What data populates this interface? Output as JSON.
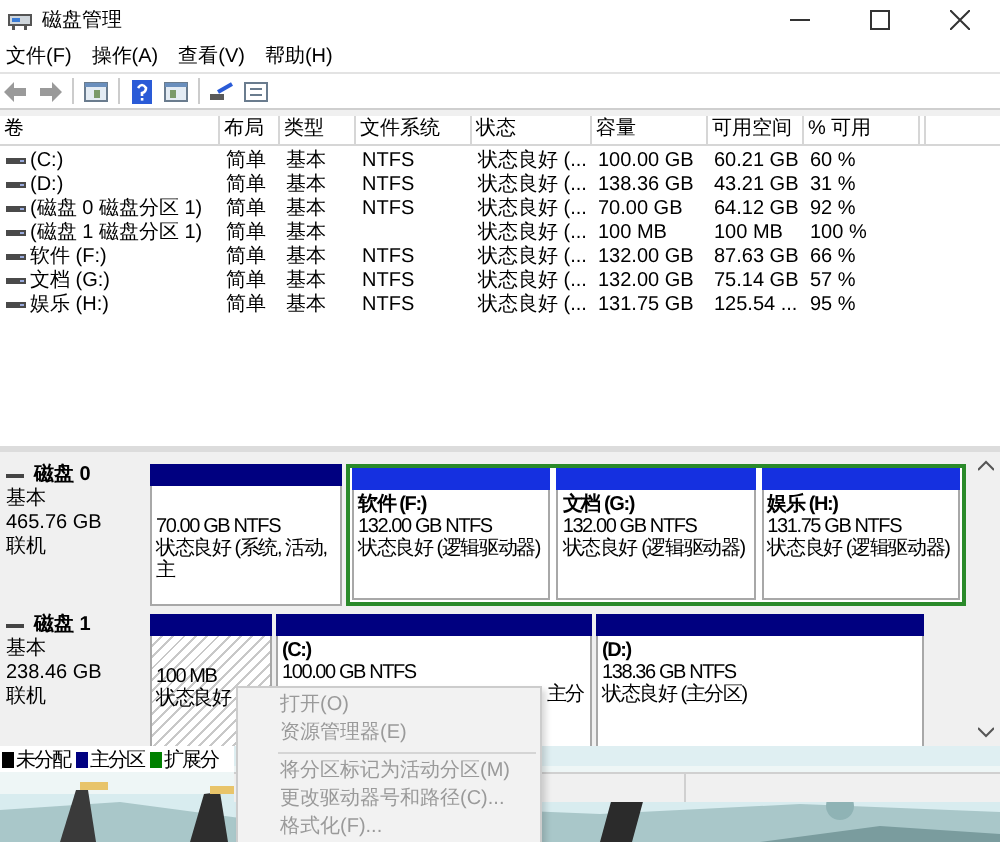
{
  "window": {
    "title": "磁盘管理"
  },
  "menu": [
    "文件(F)",
    "操作(A)",
    "查看(V)",
    "帮助(H)"
  ],
  "table": {
    "columns": [
      "卷",
      "布局",
      "类型",
      "文件系统",
      "状态",
      "容量",
      "可用空间",
      "% 可用"
    ],
    "rows": [
      {
        "volume": "(C:)",
        "layout": "简单",
        "type": "基本",
        "file_system": "NTFS",
        "status": "状态良好 (...",
        "capacity": "100.00 GB",
        "free": "60.21 GB",
        "percent_free": "60 %"
      },
      {
        "volume": "(D:)",
        "layout": "简单",
        "type": "基本",
        "file_system": "NTFS",
        "status": "状态良好 (...",
        "capacity": "138.36 GB",
        "free": "43.21 GB",
        "percent_free": "31 %"
      },
      {
        "volume": "(磁盘 0 磁盘分区 1)",
        "layout": "简单",
        "type": "基本",
        "file_system": "NTFS",
        "status": "状态良好 (...",
        "capacity": "70.00 GB",
        "free": "64.12 GB",
        "percent_free": "92 %"
      },
      {
        "volume": "(磁盘 1 磁盘分区 1)",
        "layout": "简单",
        "type": "基本",
        "status": "状态良好 (...",
        "capacity": "100 MB",
        "free": "100 MB",
        "percent_free": "100 %"
      },
      {
        "volume": "软件 (F:)",
        "layout": "简单",
        "type": "基本",
        "file_system": "NTFS",
        "status": "状态良好 (...",
        "capacity": "132.00 GB",
        "free": "87.63 GB",
        "percent_free": "66 %"
      },
      {
        "volume": "文档 (G:)",
        "layout": "简单",
        "type": "基本",
        "file_system": "NTFS",
        "status": "状态良好 (...",
        "capacity": "132.00 GB",
        "free": "75.14 GB",
        "percent_free": "57 %"
      },
      {
        "volume": "娱乐 (H:)",
        "layout": "简单",
        "type": "基本",
        "file_system": "NTFS",
        "status": "状态良好 (...",
        "capacity": "131.75 GB",
        "free": "125.54 ...",
        "percent_free": "95 %"
      }
    ]
  },
  "disks": [
    {
      "name": "磁盘 0",
      "type": "基本",
      "size": "465.76 GB",
      "status": "联机",
      "partitions": [
        {
          "kind": "primary",
          "selected": false,
          "size": "70.00 GB NTFS",
          "status": "状态良好 (系统, 活动, 主"
        },
        {
          "kind": "extended",
          "selected": false,
          "partitions": [
            {
              "kind": "logical",
              "selected": false,
              "label": "软件 (F:)",
              "size": "132.00 GB NTFS",
              "status": "状态良好 (逻辑驱动器)"
            },
            {
              "kind": "logical",
              "selected": false,
              "label": "文档 (G:)",
              "size": "132.00 GB NTFS",
              "status": "状态良好 (逻辑驱动器)"
            },
            {
              "kind": "logical",
              "selected": false,
              "label": "娱乐 (H:)",
              "size": "131.75 GB NTFS",
              "status": "状态良好 (逻辑驱动器)"
            }
          ]
        }
      ]
    },
    {
      "name": "磁盘 1",
      "type": "基本",
      "size": "238.46 GB",
      "status": "联机",
      "partitions": [
        {
          "kind": "primary",
          "selected": true,
          "size": "100 MB",
          "status": "状态良好"
        },
        {
          "kind": "primary",
          "selected": false,
          "label": "(C:)",
          "size": "100.00 GB NTFS",
          "status": "主分",
          "partly_covered": true
        },
        {
          "kind": "primary",
          "selected": false,
          "label": "(D:)",
          "size": "138.36 GB NTFS",
          "status": "状态良好 (主分区)"
        }
      ]
    }
  ],
  "legend": [
    {
      "label": "未分配",
      "color": "#000000"
    },
    {
      "label": "主分区",
      "color": "#000080"
    },
    {
      "label": "扩展分",
      "color": "#008000"
    }
  ],
  "context_menu": {
    "items": [
      {
        "kind": "item",
        "label": "打开(O)",
        "disabled": true
      },
      {
        "kind": "item",
        "label": "资源管理器(E)",
        "disabled": true
      },
      {
        "kind": "separator"
      },
      {
        "kind": "item",
        "label": "将分区标记为活动分区(M)",
        "disabled": true
      },
      {
        "kind": "item",
        "label": "更改驱动器号和路径(C)...",
        "disabled": true
      },
      {
        "kind": "item",
        "label": "格式化(F)...",
        "disabled": true
      }
    ]
  }
}
